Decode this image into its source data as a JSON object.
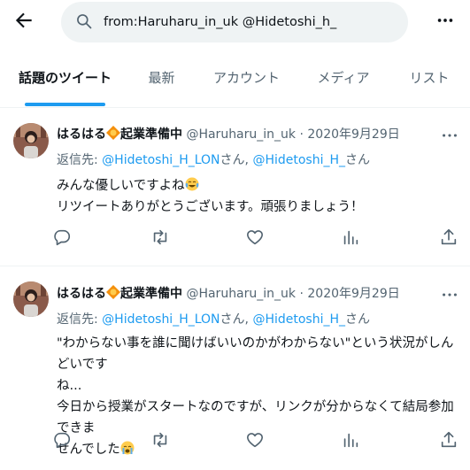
{
  "search": {
    "query": "from:Haruharu_in_uk @Hidetoshi_h_"
  },
  "tabs": [
    {
      "label": "話題のツイート",
      "active": true
    },
    {
      "label": "最新"
    },
    {
      "label": "アカウント"
    },
    {
      "label": "メディア"
    },
    {
      "label": "リスト"
    }
  ],
  "colors": {
    "accent": "#1d9bf0",
    "secondary_text": "#536471",
    "search_bg": "#eff3f4"
  },
  "tweets": [
    {
      "name_a": "はるはる",
      "name_b": "起業準備中",
      "handle": "@Haruharu_in_uk",
      "dot": "·",
      "date": "2020年9月29日",
      "reply_prefix": "返信先: ",
      "reply_user1": "@Hidetoshi_H_LON",
      "reply_mid": "さん, ",
      "reply_user2": "@Hidetoshi_H_",
      "reply_suffix": "さん",
      "line1": "みんな優しいですよね",
      "line2": "リツイートありがとうございます。頑張りましょう！",
      "emoji": "tears-of-joy-emoji"
    },
    {
      "name_a": "はるはる",
      "name_b": "起業準備中",
      "handle": "@Haruharu_in_uk",
      "dot": "·",
      "date": "2020年9月29日",
      "reply_prefix": "返信先: ",
      "reply_user1": "@Hidetoshi_H_LON",
      "reply_mid": "さん, ",
      "reply_user2": "@Hidetoshi_H_",
      "reply_suffix": "さん",
      "line1": "\"わからない事を誰に聞けばいいのかがわからない\"という状況がしんどいです",
      "line2": "ね...",
      "line3": "今日から授業がスタートなのですが、リンクが分からなくて結局参加できま",
      "line4": "せんでした",
      "emoji": "crying-emoji"
    }
  ],
  "icons": [
    "back-arrow-icon",
    "search-icon",
    "more-icon",
    "reply-icon",
    "retweet-icon",
    "like-icon",
    "views-icon",
    "share-icon"
  ]
}
